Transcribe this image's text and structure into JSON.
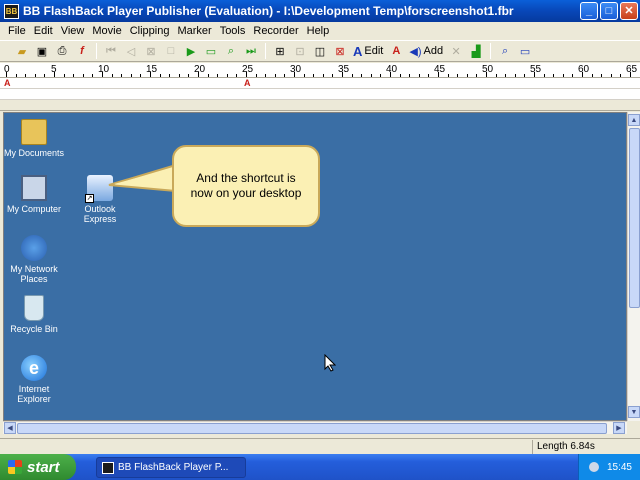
{
  "window": {
    "title": "BB FlashBack Player Publisher (Evaluation) - I:\\Development Temp\\forscreenshot1.fbr"
  },
  "menu": [
    "File",
    "Edit",
    "View",
    "Movie",
    "Clipping",
    "Marker",
    "Tools",
    "Recorder",
    "Help"
  ],
  "toolbar": {
    "edit_label": "Edit",
    "add_label": "Add"
  },
  "ruler": {
    "labels": [
      "0",
      "5",
      "10",
      "15",
      "20",
      "25",
      "30",
      "35",
      "40",
      "45",
      "50",
      "55",
      "60",
      "65"
    ],
    "marker": "A"
  },
  "desktop": {
    "icons": [
      {
        "label": "My Documents",
        "icon": "folder-icon"
      },
      {
        "label": "My Computer",
        "icon": "computer-icon"
      },
      {
        "label": "My Network Places",
        "icon": "network-icon"
      },
      {
        "label": "Recycle Bin",
        "icon": "recycle-bin-icon"
      },
      {
        "label": "Internet Explorer",
        "icon": "ie-icon"
      }
    ],
    "shortcut": {
      "label": "Outlook Express",
      "icon": "outlook-express-icon"
    },
    "callout": "And the shortcut is now on your desktop"
  },
  "status": {
    "length": "Length 6.84s"
  },
  "taskbar": {
    "start_label": "start",
    "task_label": "BB FlashBack Player P...",
    "clock": "15:45"
  }
}
